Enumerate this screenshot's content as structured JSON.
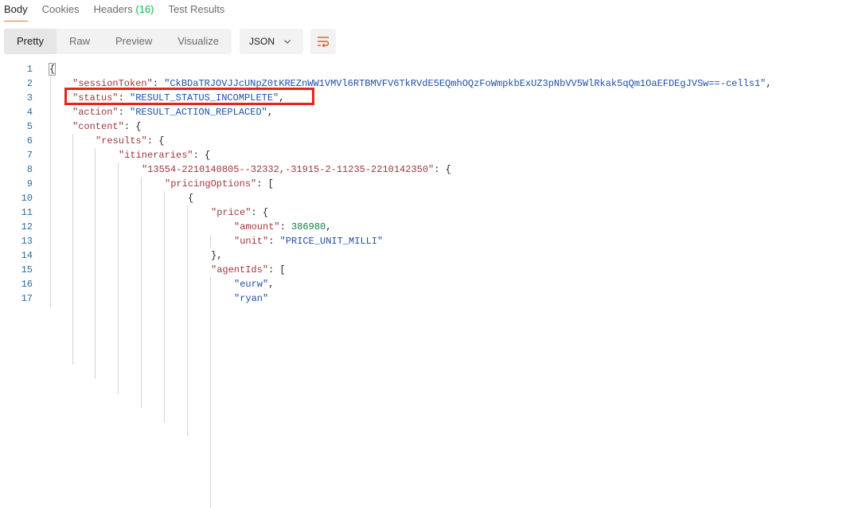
{
  "tabs": [
    {
      "label": "Body"
    },
    {
      "label": "Cookies"
    },
    {
      "label": "Headers",
      "count": "(16)"
    },
    {
      "label": "Test Results"
    }
  ],
  "toolbar": {
    "views": [
      "Pretty",
      "Raw",
      "Preview",
      "Visualize"
    ],
    "active_view": "Pretty",
    "format": "JSON",
    "icons": {
      "format_dropdown": "chevron-down-icon",
      "wrap": "wrap-lines-icon"
    }
  },
  "code": {
    "line_numbers": [
      "1",
      "2",
      "3",
      "4",
      "5",
      "6",
      "7",
      "8",
      "9",
      "10",
      "11",
      "12",
      "13",
      "14",
      "15",
      "16",
      "17"
    ],
    "lines": [
      {
        "tokens": [
          {
            "t": "p",
            "v": "{"
          }
        ]
      },
      {
        "tokens": [
          {
            "t": "k",
            "v": "\"sessionToken\""
          },
          {
            "t": "p",
            "v": ": "
          },
          {
            "t": "s",
            "v": "\"CkBDaTRJOVJJcUNpZ0tKREZnWW1VMVl6RTBMVFV6TkRVdE5EQmhOQzFoWmpkbExUZ3pNbVV5WlRkak5qQm1OaEFDEgJVSw==-cells1\""
          },
          {
            "t": "p",
            "v": ","
          }
        ]
      },
      {
        "tokens": [
          {
            "t": "k",
            "v": "\"status\""
          },
          {
            "t": "p",
            "v": ": "
          },
          {
            "t": "s",
            "v": "\"RESULT_STATUS_INCOMPLETE\""
          },
          {
            "t": "p",
            "v": ","
          }
        ]
      },
      {
        "tokens": [
          {
            "t": "k",
            "v": "\"action\""
          },
          {
            "t": "p",
            "v": ": "
          },
          {
            "t": "s",
            "v": "\"RESULT_ACTION_REPLACED\""
          },
          {
            "t": "p",
            "v": ","
          }
        ]
      },
      {
        "tokens": [
          {
            "t": "k",
            "v": "\"content\""
          },
          {
            "t": "p",
            "v": ": {"
          }
        ]
      },
      {
        "tokens": [
          {
            "t": "k",
            "v": "\"results\""
          },
          {
            "t": "p",
            "v": ": {"
          }
        ]
      },
      {
        "tokens": [
          {
            "t": "k",
            "v": "\"itineraries\""
          },
          {
            "t": "p",
            "v": ": {"
          }
        ]
      },
      {
        "tokens": [
          {
            "t": "k",
            "v": "\"13554-2210140805--32332,-31915-2-11235-2210142350\""
          },
          {
            "t": "p",
            "v": ": {"
          }
        ]
      },
      {
        "tokens": [
          {
            "t": "k",
            "v": "\"pricingOptions\""
          },
          {
            "t": "p",
            "v": ": ["
          }
        ]
      },
      {
        "tokens": [
          {
            "t": "p",
            "v": "{"
          }
        ]
      },
      {
        "tokens": [
          {
            "t": "k",
            "v": "\"price\""
          },
          {
            "t": "p",
            "v": ": {"
          }
        ]
      },
      {
        "tokens": [
          {
            "t": "k",
            "v": "\"amount\""
          },
          {
            "t": "p",
            "v": ": "
          },
          {
            "t": "n",
            "v": "386980"
          },
          {
            "t": "p",
            "v": ","
          }
        ]
      },
      {
        "tokens": [
          {
            "t": "k",
            "v": "\"unit\""
          },
          {
            "t": "p",
            "v": ": "
          },
          {
            "t": "s",
            "v": "\"PRICE_UNIT_MILLI\""
          }
        ]
      },
      {
        "tokens": [
          {
            "t": "p",
            "v": "},"
          }
        ]
      },
      {
        "tokens": [
          {
            "t": "k",
            "v": "\"agentIds\""
          },
          {
            "t": "p",
            "v": ": ["
          }
        ]
      },
      {
        "tokens": [
          {
            "t": "s",
            "v": "\"eurw\""
          },
          {
            "t": "p",
            "v": ","
          }
        ]
      },
      {
        "tokens": [
          {
            "t": "s",
            "v": "\"ryan\""
          }
        ]
      }
    ]
  }
}
